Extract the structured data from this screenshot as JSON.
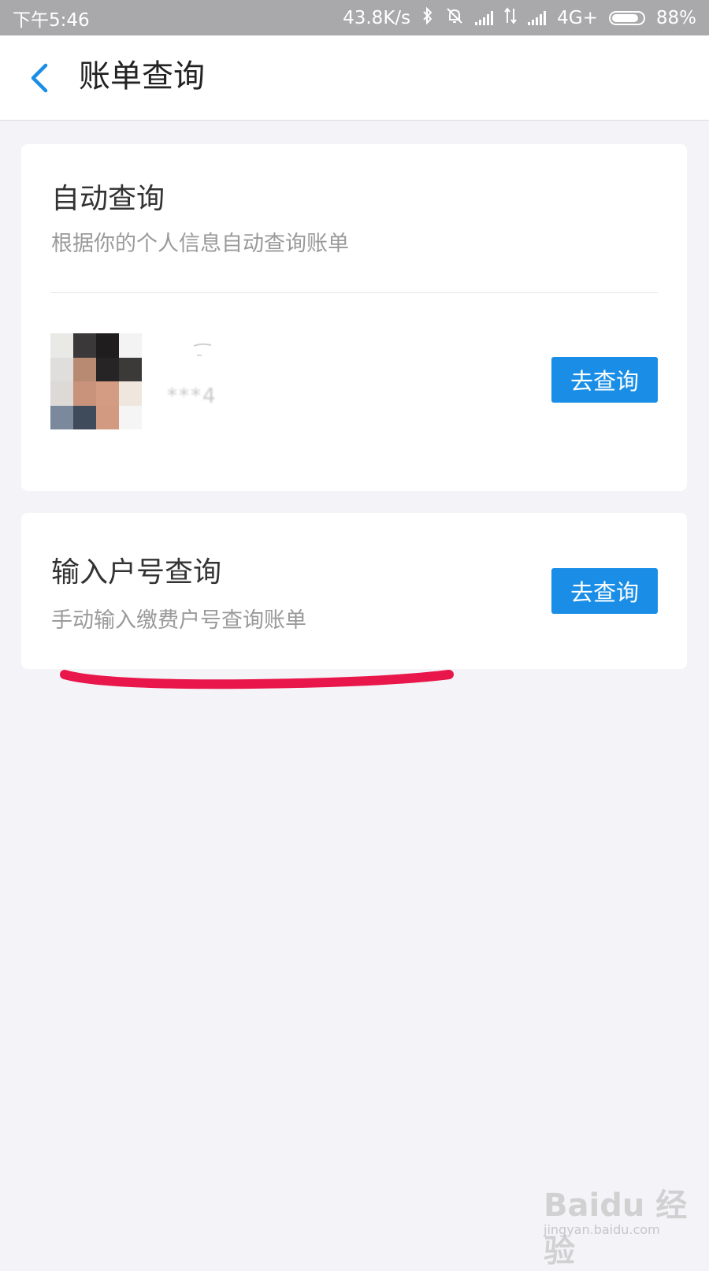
{
  "status_bar": {
    "time": "下午5:46",
    "net_speed": "43.8K/s",
    "network_type": "4G+",
    "battery_pct": "88%",
    "battery_level": 0.88,
    "icons": [
      "bluetooth-icon",
      "mute-bell-icon",
      "signal-icon",
      "data-arrows-icon",
      "signal-icon",
      "battery-icon"
    ]
  },
  "header": {
    "back_icon": "chevron-left-icon",
    "title": "账单查询"
  },
  "auto_query": {
    "title": "自动查询",
    "subtitle": "根据你的个人信息自动查询账单",
    "account_masked": "***4",
    "button_label": "去查询"
  },
  "manual_query": {
    "title": "输入户号查询",
    "subtitle": "手动输入缴费户号查询账单",
    "button_label": "去查询"
  },
  "annotation": {
    "underline_color": "#e8164a"
  },
  "watermark": {
    "logo": "Baidu 经验",
    "url": "jingyan.baidu.com"
  },
  "colors": {
    "accent": "#1a8ee6",
    "background": "#f4f3f7",
    "status_bar": "#a9a9ab"
  }
}
